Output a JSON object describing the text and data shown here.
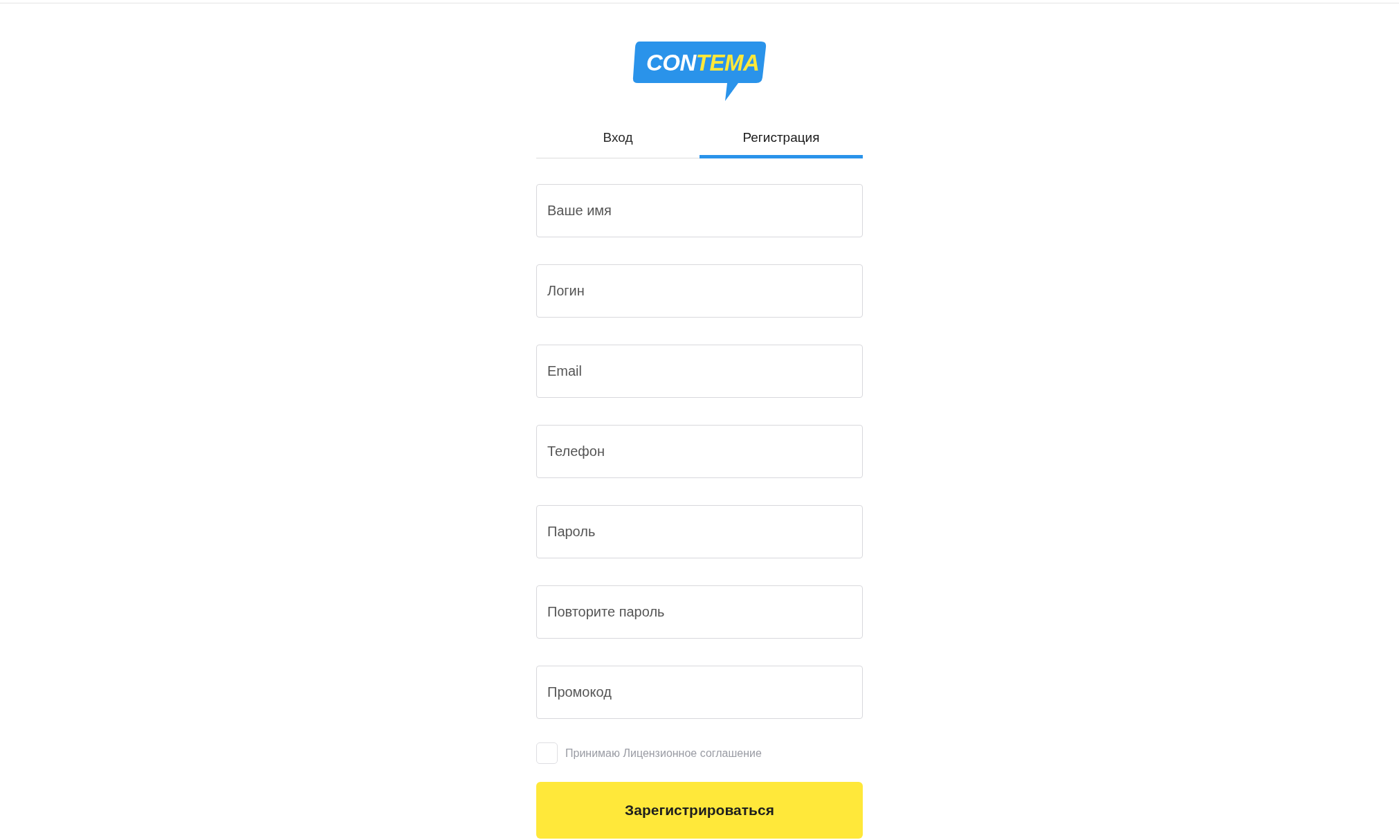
{
  "logo": {
    "parts": [
      {
        "text": "CON",
        "color": "#ffffff"
      },
      {
        "text": "TEMA",
        "color": "#ffe83a"
      }
    ]
  },
  "tabs": [
    {
      "label": "Вход",
      "selected": false
    },
    {
      "label": "Регистрация",
      "selected": true
    }
  ],
  "fields": [
    {
      "placeholder": "Ваше имя"
    },
    {
      "placeholder": "Логин"
    },
    {
      "placeholder": "Email"
    },
    {
      "placeholder": "Телефон"
    },
    {
      "placeholder": "Пароль"
    },
    {
      "placeholder": "Повторите пароль"
    },
    {
      "placeholder": "Промокод"
    }
  ],
  "agreement": {
    "label": "Принимаю Лицензионное соглашение",
    "checked": false
  },
  "submit_button": "Зарегистрироваться"
}
